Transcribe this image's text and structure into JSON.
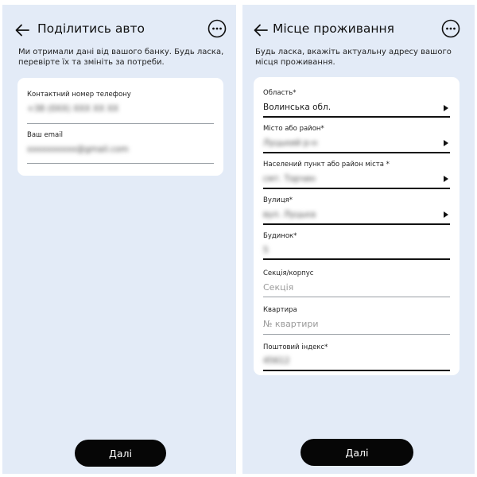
{
  "screen1": {
    "title": "Поділитись авто",
    "description": "Ми отримали дані від вашого банку. Будь ласка, перевірте їх та змініть за потреби.",
    "fields": [
      {
        "label": "Контактний номер телефону",
        "value": "+38 (0XX) XXX XX XX"
      },
      {
        "label": "Ваш email",
        "value": "xxxxxxxxxx@gmail.com"
      }
    ],
    "next_label": "Далі"
  },
  "screen2": {
    "title": "Місце проживання",
    "description": "Будь ласка, вкажіть актуальну адресу вашого місця проживання.",
    "fields": [
      {
        "label": "Область*",
        "value": "Волинська обл.",
        "dropdown": true
      },
      {
        "label": "Місто або район*",
        "value": "Луцький р-н",
        "dropdown": true
      },
      {
        "label": "Населений пункт або район міста *",
        "value": "смт. Торчин",
        "dropdown": true
      },
      {
        "label": "Вулиця*",
        "value": "вул. Луцька",
        "dropdown": true
      },
      {
        "label": "Будинок*",
        "value": "5"
      },
      {
        "label": "Секція/корпус",
        "placeholder": "Секція"
      },
      {
        "label": "Квартира",
        "placeholder": "№ квартири"
      },
      {
        "label": "Поштовий індекс*",
        "value": "45612"
      }
    ],
    "next_label": "Далі"
  },
  "icons": {
    "back": "arrow-left-icon",
    "more": "more-options-icon",
    "dropdown": "triangle-right-icon"
  }
}
